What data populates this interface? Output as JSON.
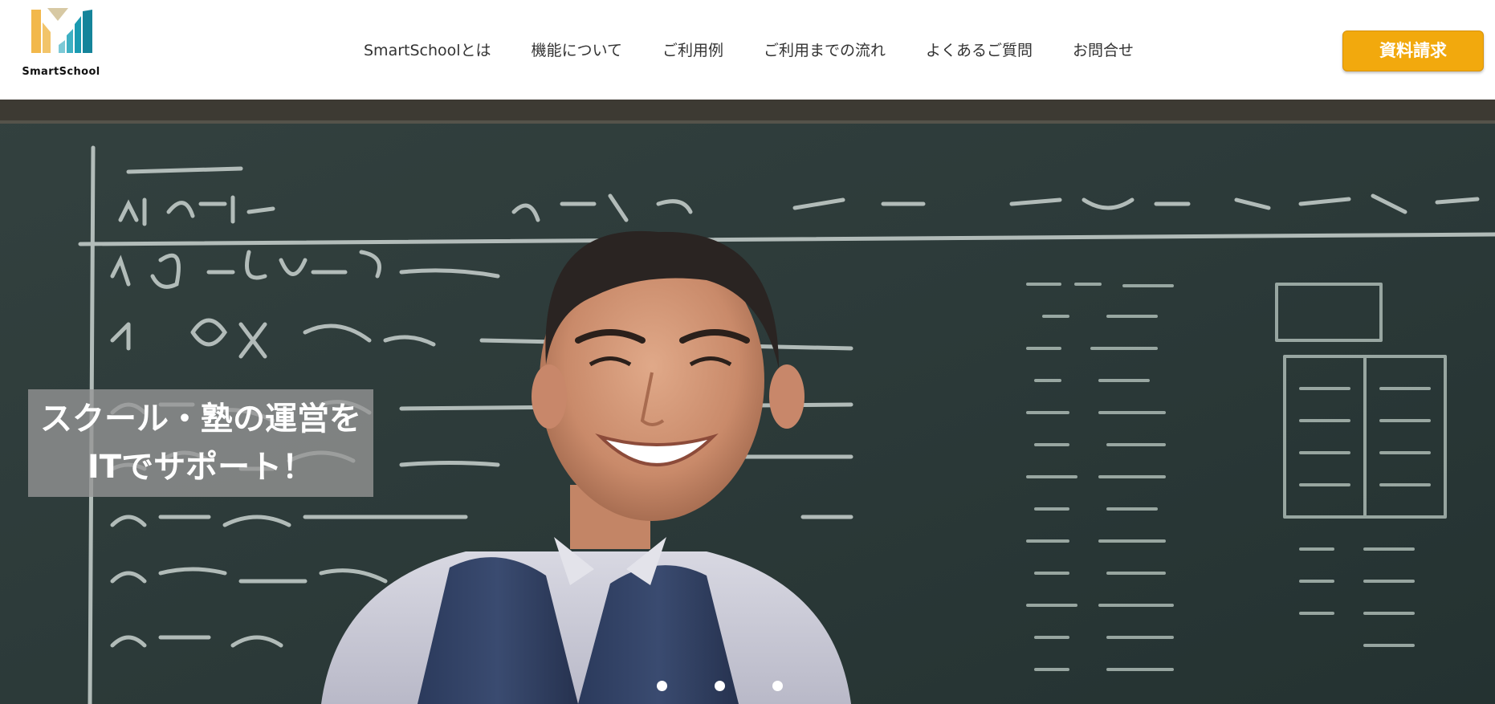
{
  "header": {
    "logo_text": "SmartSchool",
    "nav": [
      {
        "label": "SmartSchoolとは"
      },
      {
        "label": "機能について"
      },
      {
        "label": "ご利用例"
      },
      {
        "label": "ご利用までの流れ"
      },
      {
        "label": "よくあるご質問"
      },
      {
        "label": "お問合せ"
      }
    ],
    "cta_label": "資料請求"
  },
  "hero": {
    "caption_line1": "スクール・塾の運営を",
    "caption_line2": "ITでサポート！",
    "slides_count": 3,
    "active_slide": 1
  },
  "colors": {
    "accent": "#f2a90d",
    "logo_gold": "#f2b84b",
    "logo_teal": "#1a9ab1",
    "chalkboard": "#2e3d3c"
  }
}
